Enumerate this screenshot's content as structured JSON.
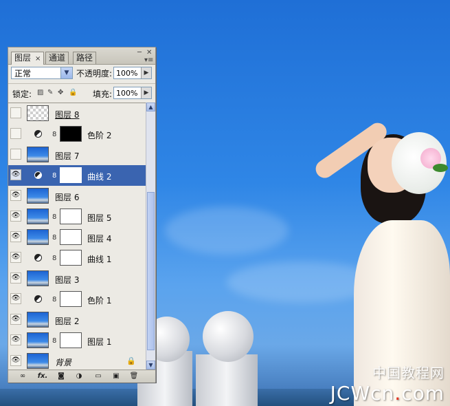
{
  "panel": {
    "tabs": [
      {
        "label": "图层",
        "active": true
      },
      {
        "label": "通道",
        "active": false
      },
      {
        "label": "路径",
        "active": false
      }
    ],
    "close_glyph": "×",
    "blend_mode": "正常",
    "opacity_label": "不透明度:",
    "opacity_value": "100%",
    "lock_label": "锁定:",
    "fill_label": "填充:",
    "fill_value": "100%"
  },
  "layers": [
    {
      "name": "图层 8",
      "visible": false,
      "thumb": "transparent",
      "mask": null,
      "adjustment": false,
      "selected": false
    },
    {
      "name": "色阶 2",
      "visible": false,
      "thumb": null,
      "mask": "black",
      "adjustment": true,
      "selected": false
    },
    {
      "name": "图层 7",
      "visible": false,
      "thumb": "photo",
      "mask": null,
      "adjustment": false,
      "selected": false
    },
    {
      "name": "曲线 2",
      "visible": true,
      "thumb": null,
      "mask": "white",
      "adjustment": true,
      "selected": true
    },
    {
      "name": "图层 6",
      "visible": true,
      "thumb": "photo",
      "mask": null,
      "adjustment": false,
      "selected": false
    },
    {
      "name": "图层 5",
      "visible": true,
      "thumb": "photo",
      "mask": "white",
      "adjustment": false,
      "selected": false
    },
    {
      "name": "图层 4",
      "visible": true,
      "thumb": "photo",
      "mask": "white",
      "adjustment": false,
      "selected": false
    },
    {
      "name": "曲线 1",
      "visible": true,
      "thumb": null,
      "mask": "white",
      "adjustment": true,
      "selected": false
    },
    {
      "name": "图层 3",
      "visible": true,
      "thumb": "photo",
      "mask": null,
      "adjustment": false,
      "selected": false
    },
    {
      "name": "色阶 1",
      "visible": true,
      "thumb": null,
      "mask": "white",
      "adjustment": true,
      "selected": false
    },
    {
      "name": "图层 2",
      "visible": true,
      "thumb": "photo",
      "mask": null,
      "adjustment": false,
      "selected": false
    },
    {
      "name": "图层 1",
      "visible": true,
      "thumb": "photo",
      "mask": "white",
      "adjustment": false,
      "selected": false
    },
    {
      "name": "背景",
      "visible": true,
      "thumb": "photo",
      "mask": null,
      "adjustment": false,
      "selected": false,
      "locked": true
    }
  ],
  "bottom_icons": [
    "link-layers-icon",
    "fx-icon",
    "add-mask-icon",
    "adjustment-layer-icon",
    "new-group-icon",
    "new-layer-icon",
    "trash-icon"
  ],
  "bottom_fx_label": "fx.",
  "watermark": {
    "cn": "中国教程网",
    "en_left": "JCWcn",
    "en_dot": ".",
    "en_right": "com"
  },
  "colors": {
    "selection": "#3a64b0",
    "sky": "#2f86e6",
    "watermark_dot": "#e53020"
  }
}
